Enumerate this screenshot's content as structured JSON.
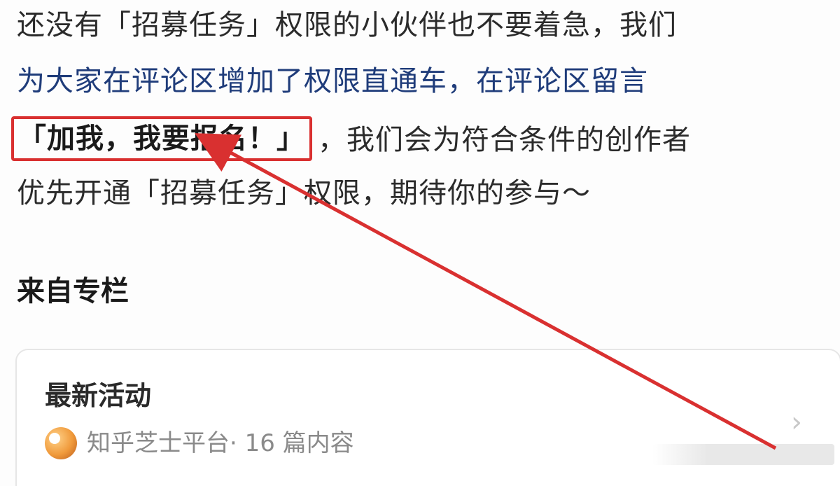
{
  "article": {
    "line1": "还没有「招募任务」权限的小伙伴也不要着急，我们",
    "line2": "为大家在评论区增加了权限直通车，在评论区留言",
    "line3_highlight": "「加我，我要报名！」",
    "line3_rest": "，我们会为符合条件的创作者",
    "line4": "优先开通「招募任务」权限，期待你的参与～"
  },
  "section": {
    "title": "来自专栏"
  },
  "card": {
    "title": "最新活动",
    "author": "知乎芝士平台",
    "meta": " · 16 篇内容",
    "chevron": "›"
  },
  "annotation": {
    "color": "#d93030"
  }
}
